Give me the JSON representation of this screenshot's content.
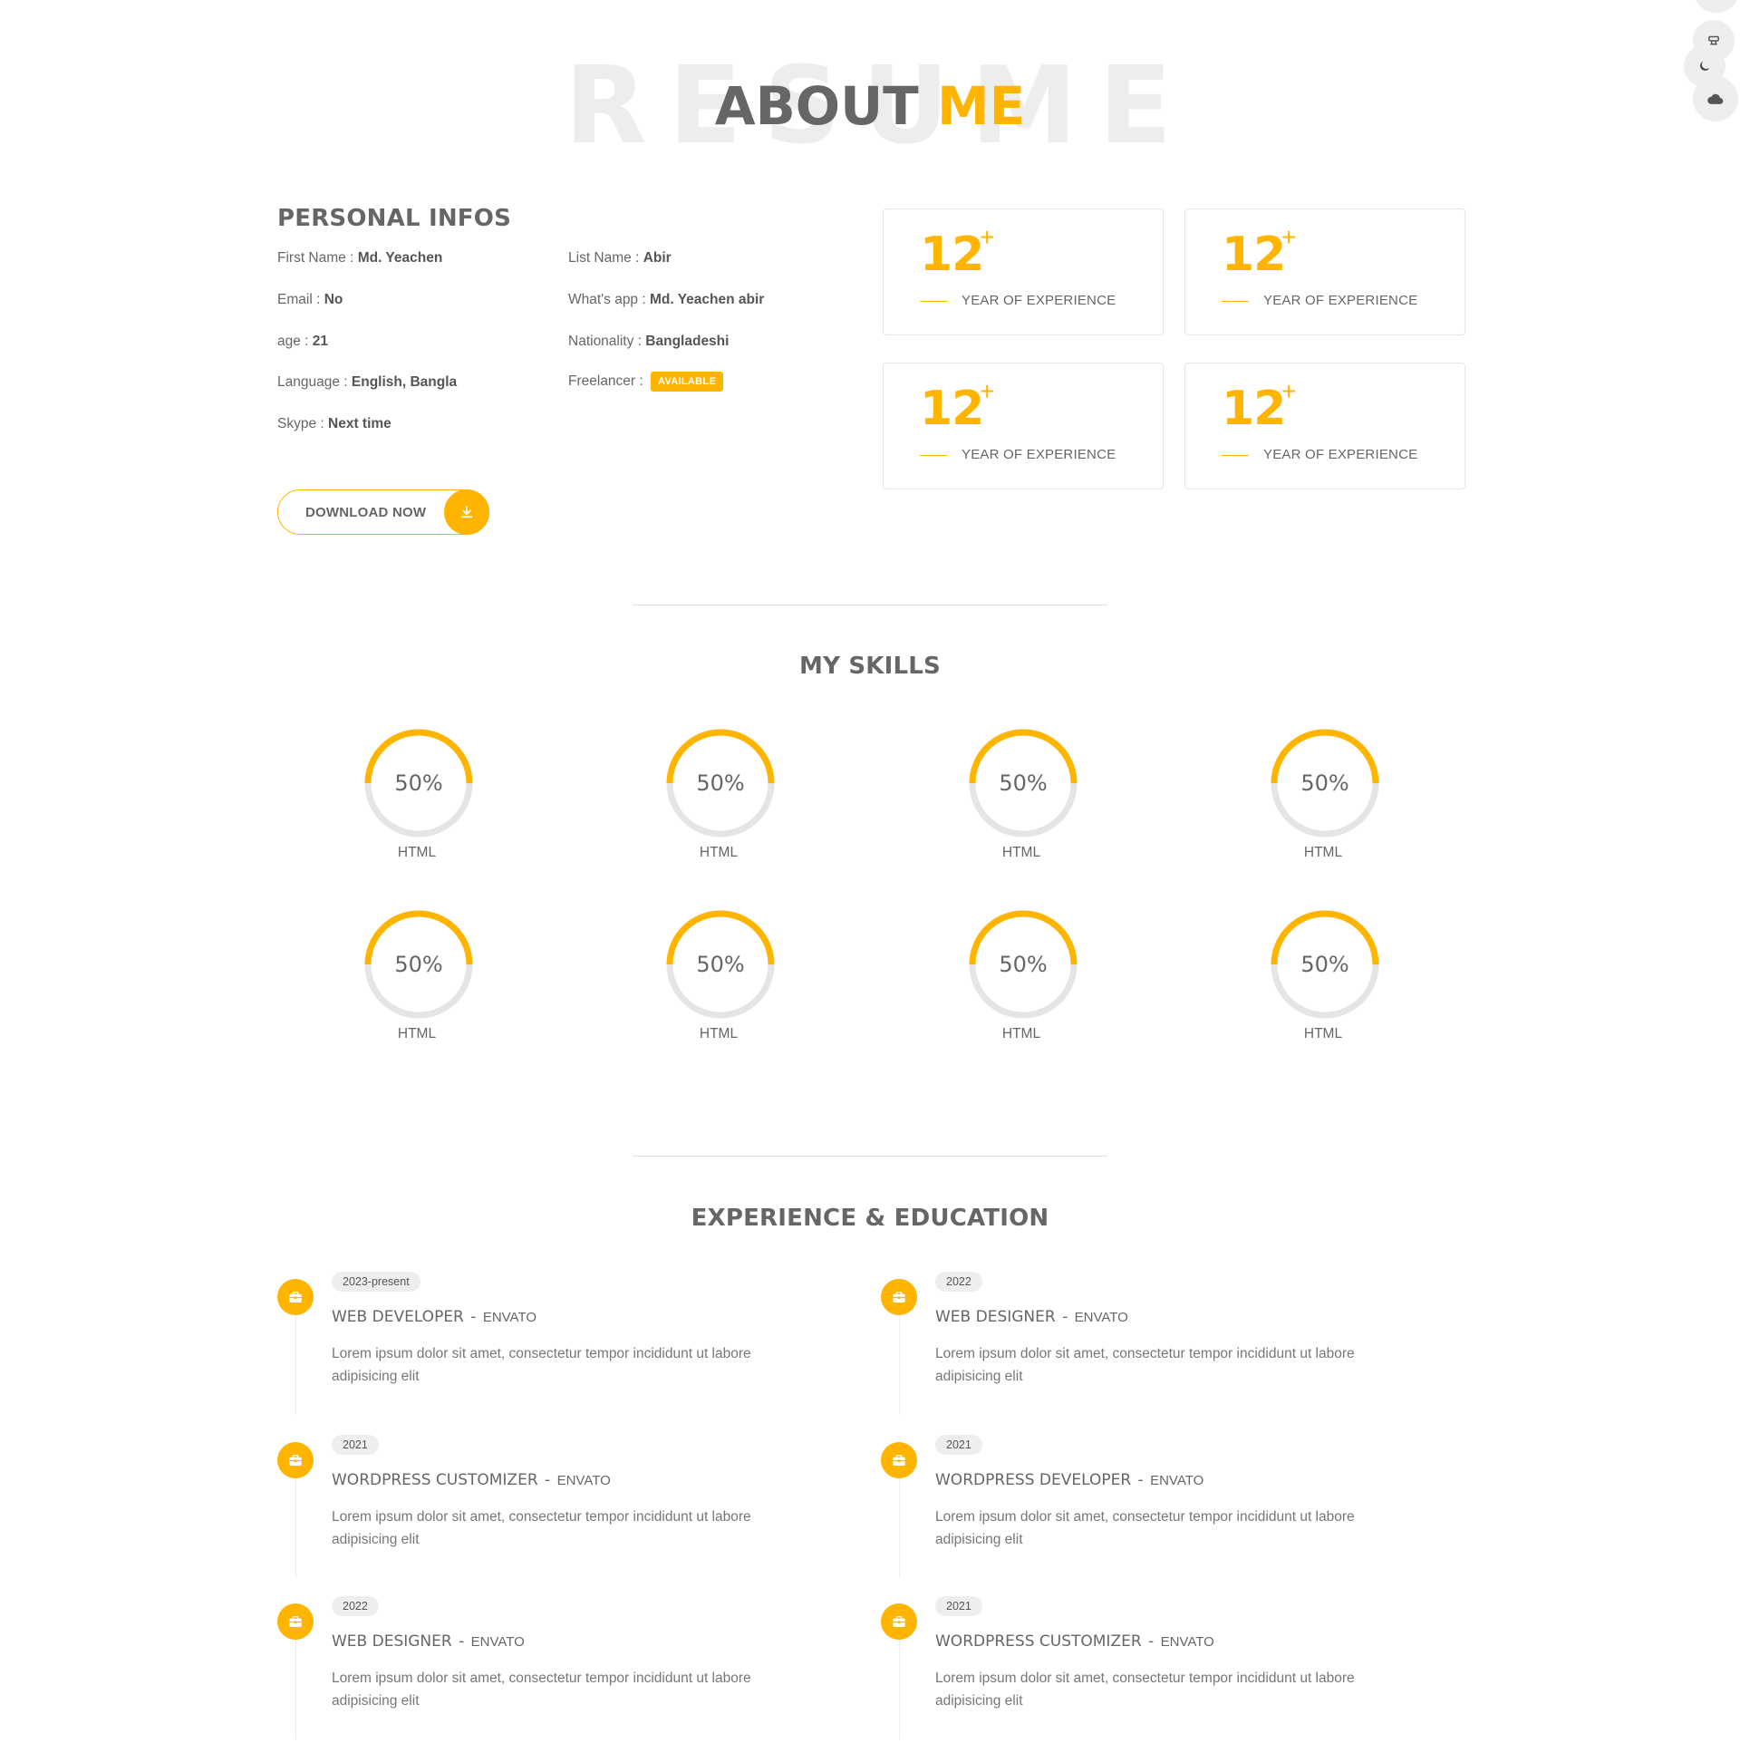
{
  "hero": {
    "bg_word": "RESUME",
    "title_main": "ABOUT",
    "title_accent": "ME"
  },
  "side_widgets": [
    "settings-icon",
    "moon-icon",
    "cloud-icon"
  ],
  "personal": {
    "heading": "PERSONAL INFOS",
    "items": [
      {
        "label": "First Name :",
        "value": "Md. Yeachen"
      },
      {
        "label": "List Name :",
        "value": "Abir"
      },
      {
        "label": "Email :",
        "value": "No"
      },
      {
        "label": "What's app :",
        "value": "Md. Yeachen abir"
      },
      {
        "label": "age :",
        "value": "21"
      },
      {
        "label": "Nationality :",
        "value": "Bangladeshi"
      },
      {
        "label": "Language :",
        "value": "English, Bangla"
      },
      {
        "label": "Freelancer :",
        "value": "AVAILABLE"
      },
      {
        "label": "Skype :",
        "value": "Next time"
      }
    ],
    "download_label": "DOWNLOAD NOW"
  },
  "stats": [
    {
      "number": "12",
      "plus": "+",
      "label": "YEAR OF EXPERIENCE"
    },
    {
      "number": "12",
      "plus": "+",
      "label": "YEAR OF EXPERIENCE"
    },
    {
      "number": "12",
      "plus": "+",
      "label": "YEAR OF EXPERIENCE"
    },
    {
      "number": "12",
      "plus": "+",
      "label": "YEAR OF EXPERIENCE"
    }
  ],
  "skills": {
    "heading": "MY SKILLS",
    "items": [
      {
        "percent": 50,
        "percent_label": "50%",
        "name": "HTML"
      },
      {
        "percent": 50,
        "percent_label": "50%",
        "name": "HTML"
      },
      {
        "percent": 50,
        "percent_label": "50%",
        "name": "HTML"
      },
      {
        "percent": 50,
        "percent_label": "50%",
        "name": "HTML"
      },
      {
        "percent": 50,
        "percent_label": "50%",
        "name": "HTML"
      },
      {
        "percent": 50,
        "percent_label": "50%",
        "name": "HTML"
      },
      {
        "percent": 50,
        "percent_label": "50%",
        "name": "HTML"
      },
      {
        "percent": 50,
        "percent_label": "50%",
        "name": "HTML"
      }
    ]
  },
  "experience": {
    "heading": "EXPERIENCE & EDUCATION",
    "items": [
      {
        "year": "2023-present",
        "title": "WEB DEVELOPER",
        "dash": "-",
        "company": "ENVATO",
        "desc": "Lorem ipsum dolor sit amet, consectetur tempor incididunt ut labore adipisicing elit"
      },
      {
        "year": "2022",
        "title": "WEB DESIGNER",
        "dash": "-",
        "company": "ENVATO",
        "desc": "Lorem ipsum dolor sit amet, consectetur tempor incididunt ut labore adipisicing elit"
      },
      {
        "year": "2021",
        "title": "WORDPRESS CUSTOMIZER",
        "dash": "-",
        "company": "ENVATO",
        "desc": "Lorem ipsum dolor sit amet, consectetur tempor incididunt ut labore adipisicing elit"
      },
      {
        "year": "2021",
        "title": "WORDPRESS DEVELOPER",
        "dash": "-",
        "company": "ENVATO",
        "desc": "Lorem ipsum dolor sit amet, consectetur tempor incididunt ut labore adipisicing elit"
      },
      {
        "year": "2022",
        "title": "WEB DESIGNER",
        "dash": "-",
        "company": "ENVATO",
        "desc": "Lorem ipsum dolor sit amet, consectetur tempor incididunt ut labore adipisicing elit"
      },
      {
        "year": "2021",
        "title": "WORDPRESS CUSTOMIZER",
        "dash": "-",
        "company": "ENVATO",
        "desc": "Lorem ipsum dolor sit amet, consectetur tempor incididunt ut labore adipisicing elit"
      }
    ],
    "item_icon": "briefcase-icon"
  },
  "colors": {
    "accent": "#ffb400",
    "text": "#666666",
    "track": "#e5e5e5"
  }
}
